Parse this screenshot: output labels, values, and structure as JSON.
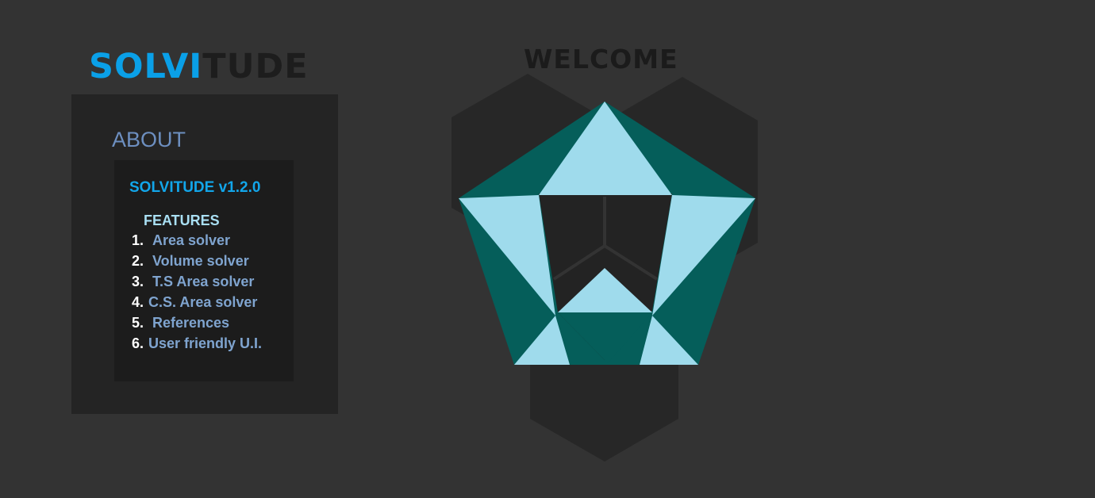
{
  "logo": {
    "part1": "SOLVI",
    "part2": "TUDE"
  },
  "about": {
    "title": "ABOUT",
    "version": "SOLVITUDE v1.2.0",
    "features_title": "FEATURES",
    "features": [
      {
        "num": "1.",
        "label": "Area solver"
      },
      {
        "num": "2.",
        "label": "Volume solver"
      },
      {
        "num": "3.",
        "label": "T.S Area solver"
      },
      {
        "num": "4.",
        "label": "C.S. Area solver"
      },
      {
        "num": "5.",
        "label": "References"
      },
      {
        "num": "6.",
        "label": "User friendly U.I."
      }
    ]
  },
  "welcome": "WELCOME",
  "colors": {
    "background": "#333333",
    "panel": "#242424",
    "accent_blue": "#0aa0e8",
    "teal_dark": "#055e5a",
    "teal_light": "#9fdbec"
  }
}
